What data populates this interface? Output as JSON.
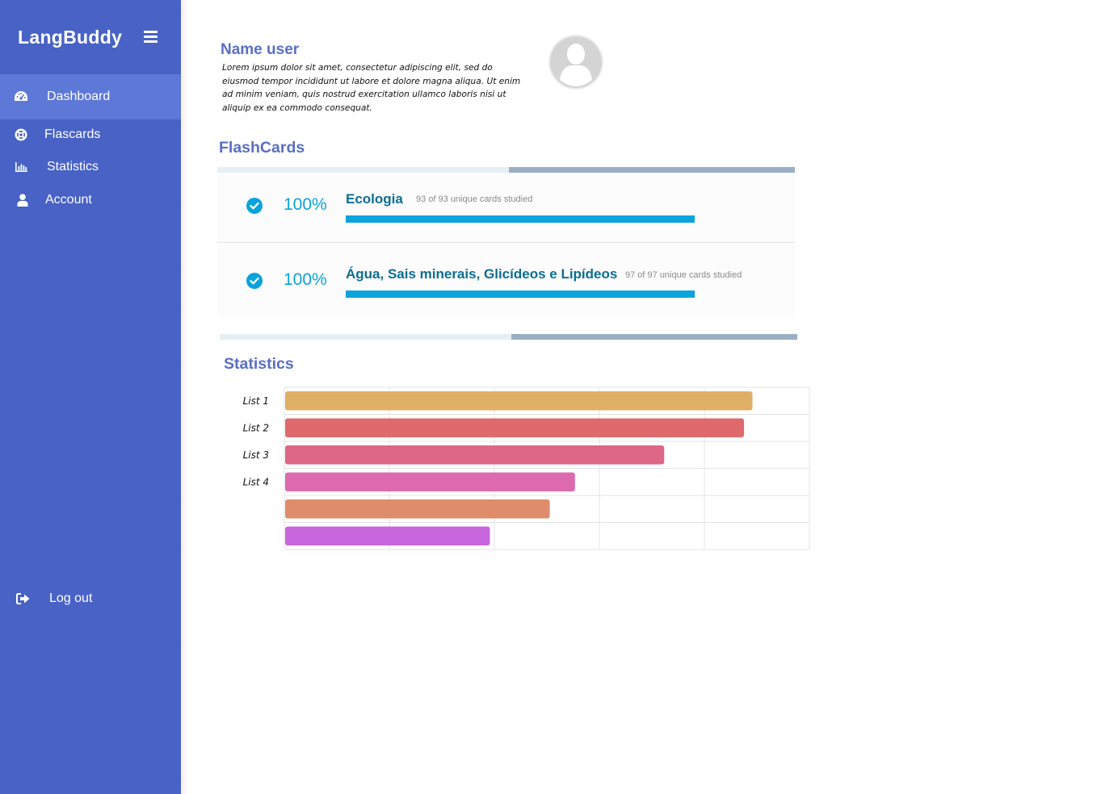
{
  "app": {
    "title": "LangBuddy"
  },
  "sidebar": {
    "items": [
      {
        "label": "Dashboard",
        "icon": "dashboard-icon",
        "active": true
      },
      {
        "label": "Flascards",
        "icon": "lifebuoy-icon",
        "active": false
      },
      {
        "label": "Statistics",
        "icon": "bar-chart-icon",
        "active": false
      },
      {
        "label": "Account",
        "icon": "user-icon",
        "active": false
      }
    ],
    "logout": {
      "label": "Log out",
      "icon": "sign-out-icon"
    }
  },
  "profile": {
    "name": "Name user",
    "bio": "Lorem ipsum dolor sit amet, consectetur adipiscing elit, sed do eiusmod tempor incididunt ut labore et dolore magna aliqua. Ut enim ad minim veniam, quis nostrud exercitation ullamco laboris nisi ut aliquip ex ea commodo consequat."
  },
  "flashcards": {
    "title": "FlashCards",
    "decks": [
      {
        "percent": "100%",
        "title": "Ecologia",
        "meta": "93 of 93 unique cards studied",
        "progress": 1.0
      },
      {
        "percent": "100%",
        "title": "Água, Sais minerais, Glicídeos e Lipídeos",
        "meta": "97 of 97 unique cards studied",
        "progress": 1.0
      }
    ]
  },
  "statistics": {
    "title": "Statistics"
  },
  "chart_data": {
    "type": "bar",
    "orientation": "horizontal",
    "categories": [
      "List 1",
      "List 2",
      "List 3",
      "List 4",
      "",
      ""
    ],
    "values": [
      4.45,
      4.37,
      3.61,
      2.76,
      2.52,
      1.95
    ],
    "xlim": [
      0,
      5
    ],
    "grid": true,
    "colors": [
      "#deaf65",
      "#df6a6e",
      "#de6686",
      "#dd6aae",
      "#df8c6a",
      "#c867dd"
    ]
  }
}
